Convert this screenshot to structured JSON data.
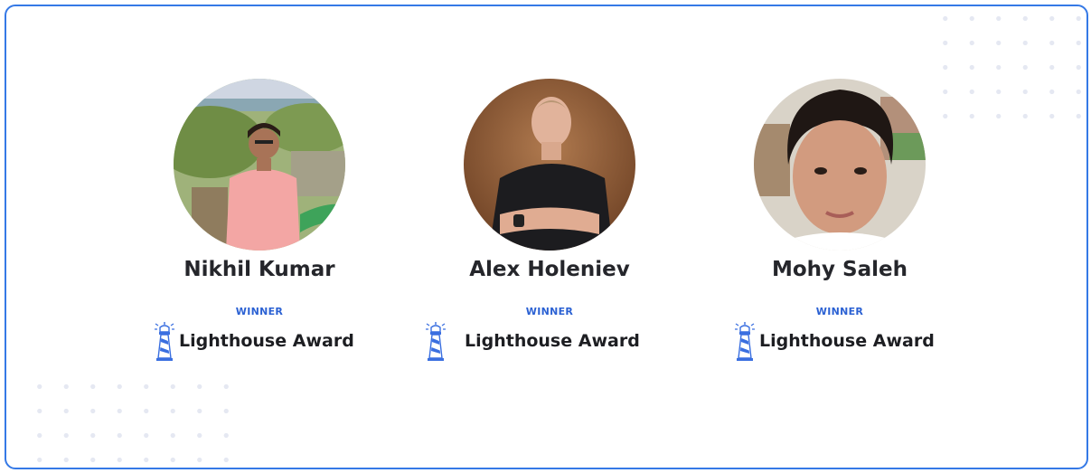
{
  "winners": [
    {
      "name": "Nikhil Kumar",
      "badge_label": "WINNER",
      "award": "Lighthouse Award",
      "avatar_icon": "avatar-photo"
    },
    {
      "name": "Alex Holeniev",
      "badge_label": "WINNER",
      "award": "Lighthouse Award",
      "avatar_icon": "avatar-photo"
    },
    {
      "name": "Mohy Saleh",
      "badge_label": "WINNER",
      "award": "Lighthouse Award",
      "avatar_icon": "avatar-photo"
    }
  ],
  "colors": {
    "border": "#3579e6",
    "badge_label": "#2b61d3",
    "name": "#25262b",
    "award_text": "#1d1e22",
    "icon": "#3a6fe0"
  },
  "icons": {
    "award_icon": "lighthouse-icon"
  }
}
